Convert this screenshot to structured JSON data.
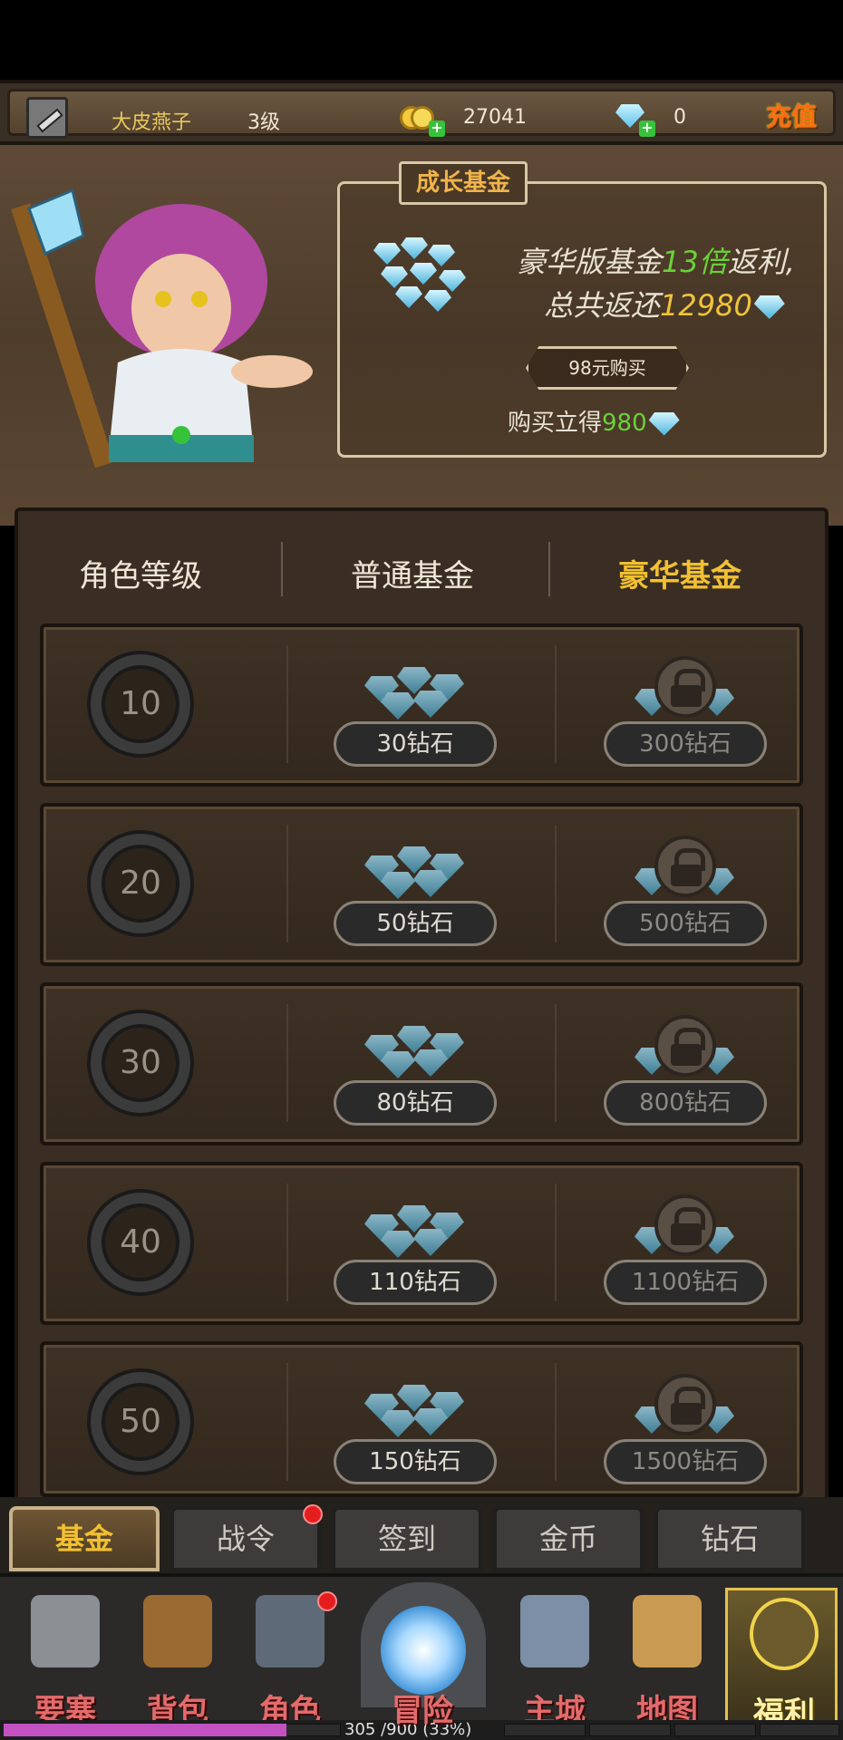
{
  "topbar": {
    "player_name": "大皮燕子",
    "level": "3级",
    "gold": "27041",
    "diamonds": "0",
    "recharge_label": "充值"
  },
  "growth_fund": {
    "title": "成长基金",
    "line1_prefix": "豪华版基金",
    "line1_highlight": "13倍",
    "line1_suffix": "返利,",
    "line2_prefix": "总共返还",
    "line2_highlight": "12980",
    "buy_button": "98元购买",
    "instant_prefix": "购买立得",
    "instant_highlight": "980"
  },
  "table_headers": {
    "level": "角色等级",
    "normal": "普通基金",
    "deluxe": "豪华基金"
  },
  "rows": [
    {
      "level": "10",
      "normal": "30钻石",
      "deluxe": "300钻石"
    },
    {
      "level": "20",
      "normal": "50钻石",
      "deluxe": "500钻石"
    },
    {
      "level": "30",
      "normal": "80钻石",
      "deluxe": "800钻石"
    },
    {
      "level": "40",
      "normal": "110钻石",
      "deluxe": "1100钻石"
    },
    {
      "level": "50",
      "normal": "150钻石",
      "deluxe": "1500钻石"
    }
  ],
  "tabs": [
    "基金",
    "战令",
    "签到",
    "金币",
    "钻石"
  ],
  "nav": [
    "要塞",
    "背包",
    "角色",
    "冒险",
    "主城",
    "地图",
    "福利"
  ],
  "xp": {
    "text": "305 /900 (33%)",
    "current": 305,
    "max": 900
  },
  "colors": {
    "accent_gold": "#f2c031",
    "highlight_green": "#6ad23a",
    "nav_label": "#e36b6b",
    "xp_fill": "#c252c2"
  }
}
